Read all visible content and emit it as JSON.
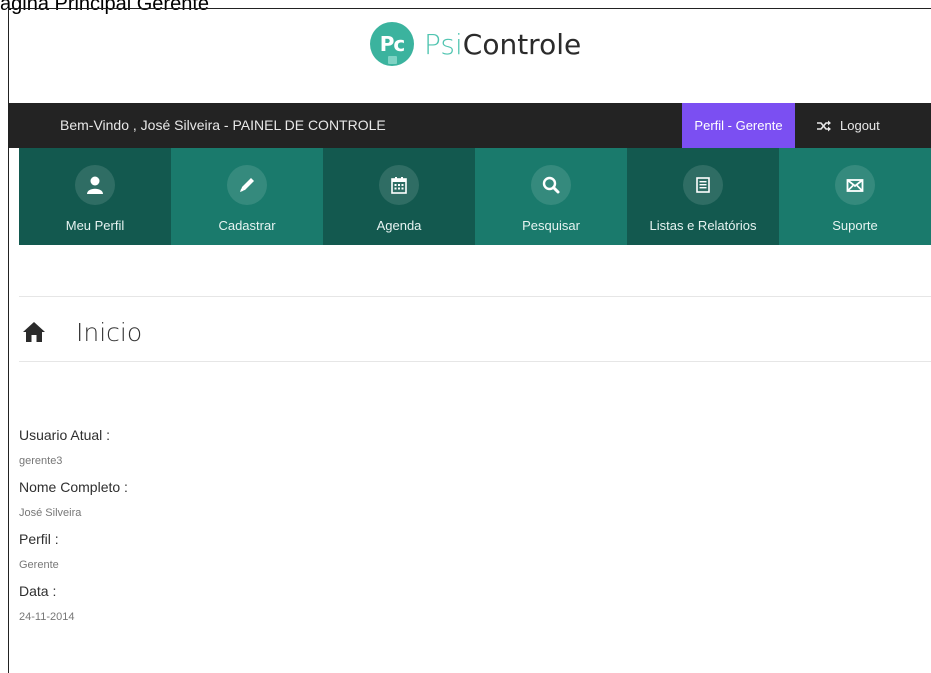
{
  "caption": "ágina Principal Gerente",
  "brand": {
    "logo_text": "Pc",
    "name_part1": "Psi",
    "name_part2": "Controle"
  },
  "topbar": {
    "welcome": "Bem-Vindo , José  Silveira - PAINEL DE CONTROLE",
    "perfil": "Perfil - Gerente",
    "logout": "Logout"
  },
  "nav": [
    {
      "label": "Meu Perfil",
      "icon": "user-icon"
    },
    {
      "label": "Cadastrar",
      "icon": "pencil-icon"
    },
    {
      "label": "Agenda",
      "icon": "calendar-icon"
    },
    {
      "label": "Pesquisar",
      "icon": "search-icon"
    },
    {
      "label": "Listas e Relatórios",
      "icon": "list-icon"
    },
    {
      "label": "Suporte",
      "icon": "envelope-icon"
    }
  ],
  "page": {
    "title": "Inicio"
  },
  "info": {
    "user_label": "Usuario Atual :",
    "user_value": "gerente3",
    "name_label": "Nome Completo :",
    "name_value": "José Silveira",
    "perfil_label": "Perfil :",
    "perfil_value": "Gerente",
    "date_label": "Data :",
    "date_value": "24-11-2014"
  },
  "colors": {
    "nav_dark": "#13594f",
    "nav_light": "#1a7a6c",
    "topbar": "#232323",
    "perfil_accent": "#7b4ff2",
    "brand_teal": "#3bb39e"
  }
}
